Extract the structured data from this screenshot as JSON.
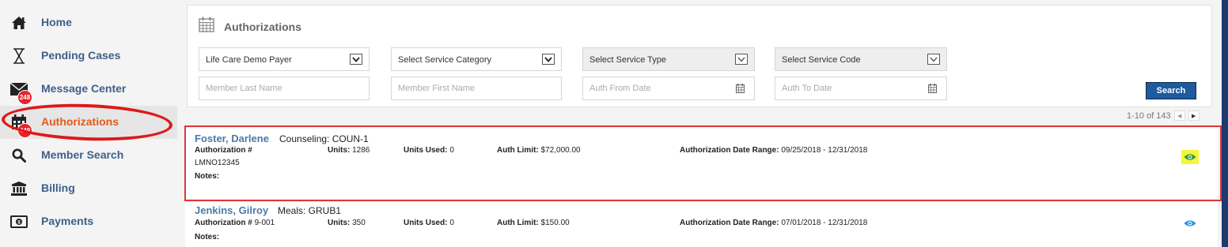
{
  "sidebar": {
    "items": [
      {
        "label": "Home",
        "icon": "home-icon"
      },
      {
        "label": "Pending Cases",
        "icon": "hourglass-icon"
      },
      {
        "label": "Message Center",
        "icon": "envelope-icon",
        "badge": "248"
      },
      {
        "label": "Authorizations",
        "icon": "calendar-icon",
        "badge": "449",
        "active": true
      },
      {
        "label": "Member Search",
        "icon": "search-icon"
      },
      {
        "label": "Billing",
        "icon": "bank-icon"
      },
      {
        "label": "Payments",
        "icon": "money-icon"
      }
    ]
  },
  "panel": {
    "title": "Authorizations",
    "payer_value": "Life Care Demo Payer",
    "service_category_value": "Select Service Category",
    "service_type_value": "Select Service Type",
    "service_code_value": "Select Service Code",
    "last_name_placeholder": "Member Last Name",
    "first_name_placeholder": "Member First Name",
    "auth_from_placeholder": "Auth From Date",
    "auth_to_placeholder": "Auth To Date",
    "search_label": "Search"
  },
  "pager": {
    "text": "1-10 of 143"
  },
  "results": [
    {
      "name": "Foster, Darlene",
      "service": "Counseling: COUN-1",
      "auth_label": "Authorization #",
      "auth_number": "LMNO12345",
      "units_label": "Units:",
      "units": "1286",
      "units_used_label": "Units Used:",
      "units_used": "0",
      "auth_limit_label": "Auth Limit:",
      "auth_limit": "$72,000.00",
      "date_range_label": "Authorization Date Range:",
      "date_range": "09/25/2018 - 12/31/2018",
      "notes_label": "Notes:"
    },
    {
      "name": "Jenkins, Gilroy",
      "service": "Meals: GRUB1",
      "auth_label": "Authorization #",
      "auth_number": "9-001",
      "units_label": "Units:",
      "units": "350",
      "units_used_label": "Units Used:",
      "units_used": "0",
      "auth_limit_label": "Auth Limit:",
      "auth_limit": "$150.00",
      "date_range_label": "Authorization Date Range:",
      "date_range": "07/01/2018 - 12/31/2018",
      "notes_label": "Notes:"
    }
  ],
  "colors": {
    "link": "#4d78a8",
    "active": "#e35a1b",
    "badge": "#e8222b",
    "button": "#1d5a9e",
    "annotation": "#dd1a1a"
  }
}
